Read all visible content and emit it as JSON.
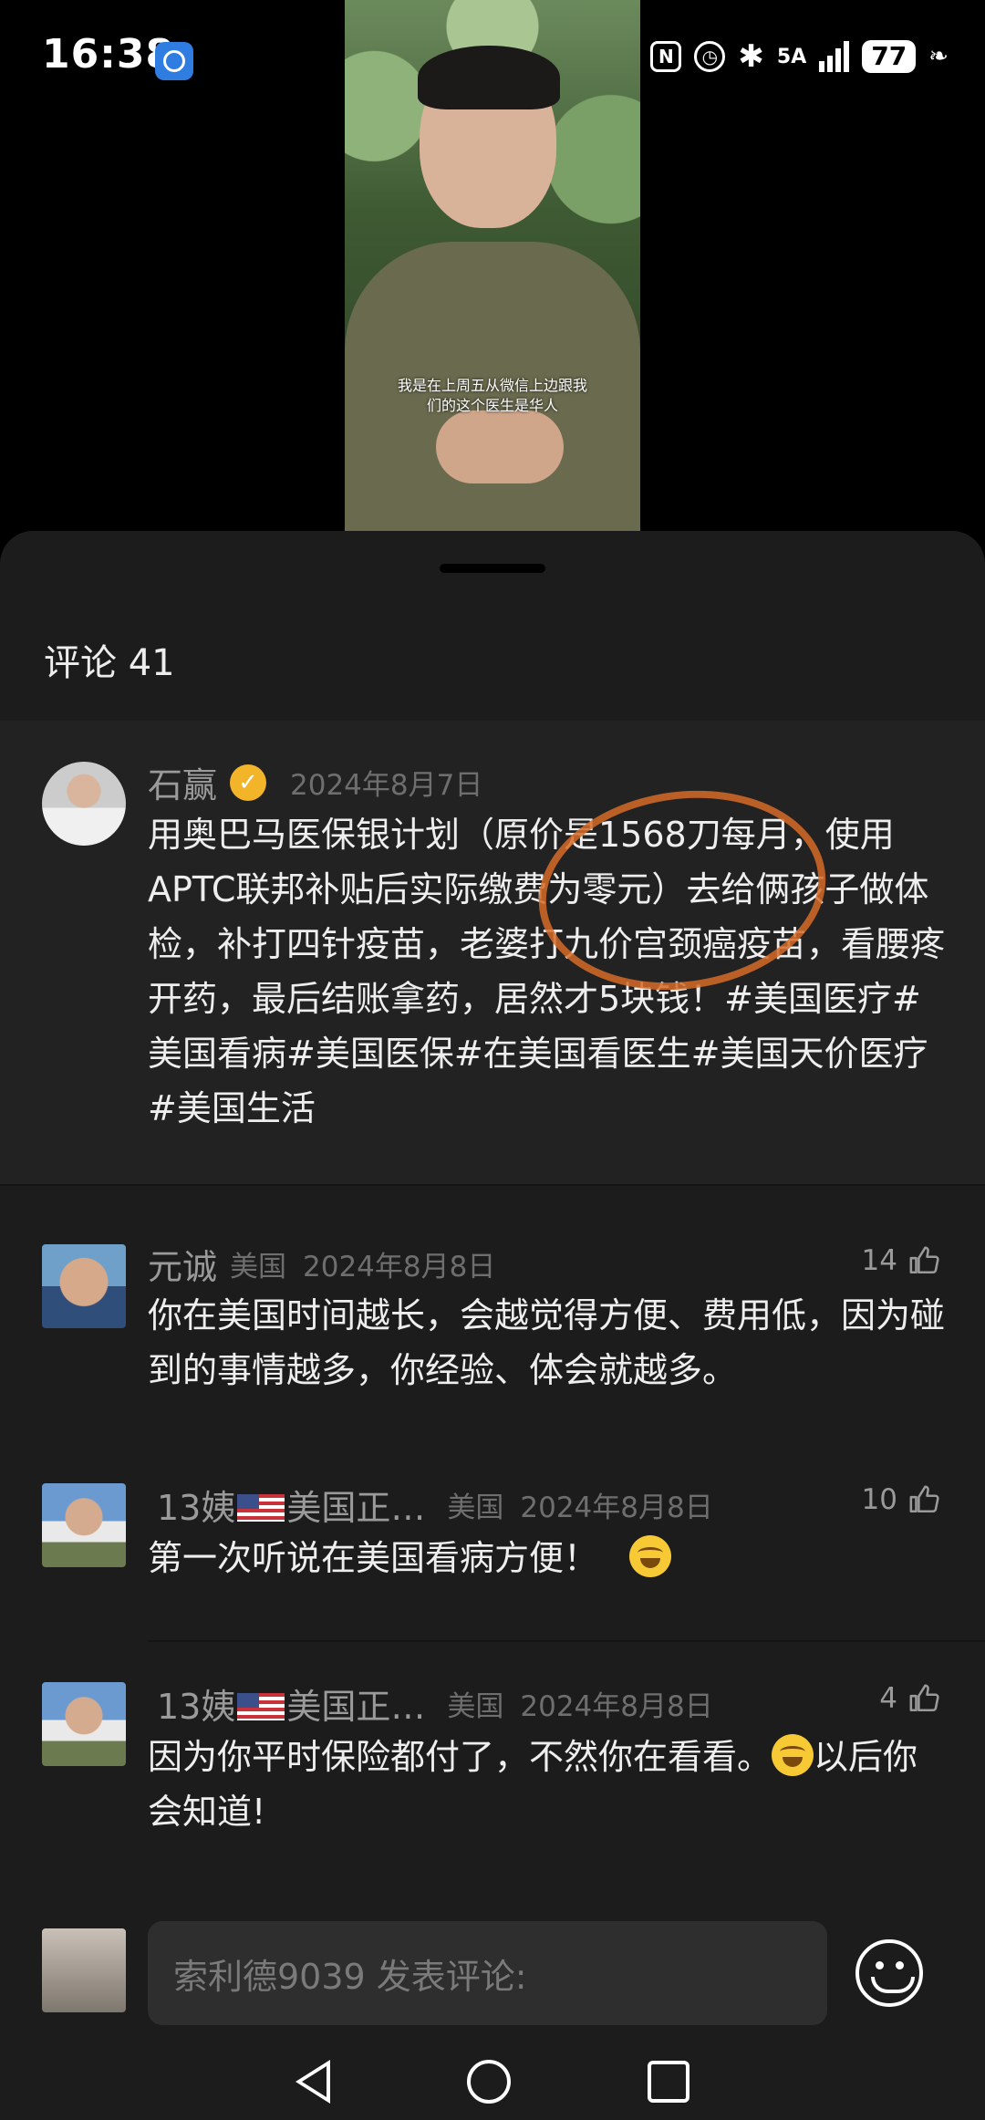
{
  "status_bar": {
    "time": "16:38",
    "network": "5A",
    "battery": "77"
  },
  "video": {
    "subtitle_line1": "我是在上周五从微信上边跟我",
    "subtitle_line2": "们的这个医生是华人"
  },
  "sheet": {
    "title": "评论 41"
  },
  "comments": [
    {
      "name": "石赢",
      "verified": true,
      "date": "2024年8月7日",
      "text": "用奥巴马医保银计划（原价是1568刀每月，使用APTC联邦补贴后实际缴费为零元）去给俩孩子做体检，补打四针疫苗，老婆打九价宫颈癌疫苗，看腰疼开药，最后结账拿药，居然才5块钱！#美国医疗#美国看病#美国医保#在美国看医生#美国天价医疗#美国生活"
    },
    {
      "name": "元诚",
      "location": "美国",
      "date": "2024年8月8日",
      "likes": "14",
      "text": "你在美国时间越长，会越觉得方便、费用低，因为碰到的事情越多，你经验、体会就越多。"
    },
    {
      "name_prefix": "13姨",
      "name_suffix": "美国正…",
      "location": "美国",
      "date": "2024年8月8日",
      "likes": "10",
      "text": "第一次听说在美国看病方便！"
    },
    {
      "name_prefix": "13姨",
      "name_suffix": "美国正…",
      "location": "美国",
      "date": "2024年8月8日",
      "likes": "4",
      "text_a": "因为你平时保险都付了，不然你在看看。",
      "text_b": "以后你会知道!"
    }
  ],
  "input": {
    "placeholder": "索利德9039 发表评论:"
  },
  "colors": {
    "sheet_bg": "#1c1c1c",
    "verified": "#f2b52a",
    "annotation_circle": "#d56a27"
  }
}
